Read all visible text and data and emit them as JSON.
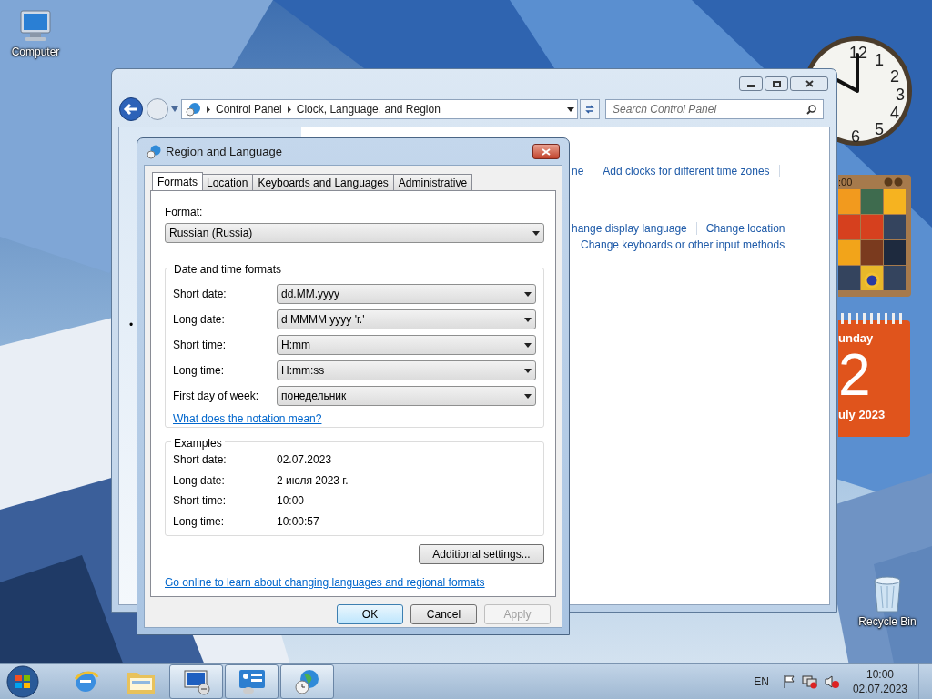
{
  "desktop_icons": [
    {
      "kind": "computer",
      "label": "Computer"
    },
    {
      "kind": "recycle",
      "label": "Recycle Bin"
    }
  ],
  "gadgets": {
    "clock_numerals": [
      "12",
      "1",
      "2",
      "3",
      "4",
      "5",
      "6"
    ],
    "puzzle_time": ":00",
    "calendar": {
      "weekday": "unday",
      "day": "2",
      "month": "uly 2023"
    }
  },
  "control_panel": {
    "breadcrumb": [
      "Control Panel",
      "Clock, Language, and Region"
    ],
    "search": {
      "placeholder": "Search Control Panel"
    },
    "bullet": "•",
    "link_rows": [
      [
        "ne",
        "Add clocks for different time zones"
      ],
      [
        "hange display language",
        "Change location"
      ],
      [
        "Change keyboards or other input methods"
      ]
    ]
  },
  "dialog": {
    "title": "Region and Language",
    "tabs": [
      {
        "label": "Formats",
        "selected": true
      },
      {
        "label": "Location",
        "selected": false
      },
      {
        "label": "Keyboards and Languages",
        "selected": false
      },
      {
        "label": "Administrative",
        "selected": false
      }
    ],
    "format": {
      "label": "Format:",
      "value": "Russian (Russia)"
    },
    "date_time_formats": {
      "title": "Date and time formats",
      "rows": [
        {
          "label": "Short date:",
          "value": "dd.MM.yyyy"
        },
        {
          "label": "Long date:",
          "value": "d MMMM yyyy 'г.'"
        },
        {
          "label": "Short time:",
          "value": "H:mm"
        },
        {
          "label": "Long time:",
          "value": "H:mm:ss"
        },
        {
          "label": "First day of week:",
          "value": "понедельник"
        }
      ],
      "link": "What does the notation mean?"
    },
    "examples": {
      "title": "Examples",
      "rows": [
        {
          "label": "Short date:",
          "value": "02.07.2023"
        },
        {
          "label": "Long date:",
          "value": "2 июля 2023 г."
        },
        {
          "label": "Short time:",
          "value": "10:00"
        },
        {
          "label": "Long time:",
          "value": "10:00:57"
        }
      ]
    },
    "additional_button": "Additional settings...",
    "online_link": "Go online to learn about changing languages and regional formats",
    "buttons": [
      {
        "label": "OK",
        "disabled": false,
        "default": true
      },
      {
        "label": "Cancel",
        "disabled": false,
        "default": false
      },
      {
        "label": "Apply",
        "disabled": true,
        "default": false
      }
    ]
  },
  "taskbar": {
    "items": [
      {
        "kind": "ie",
        "active": false
      },
      {
        "kind": "explorer",
        "active": false
      },
      {
        "kind": "remote",
        "active": true
      },
      {
        "kind": "panel",
        "active": true
      },
      {
        "kind": "globe",
        "active": true
      }
    ],
    "language": "EN",
    "time": "10:00",
    "date": "02.07.2023"
  }
}
